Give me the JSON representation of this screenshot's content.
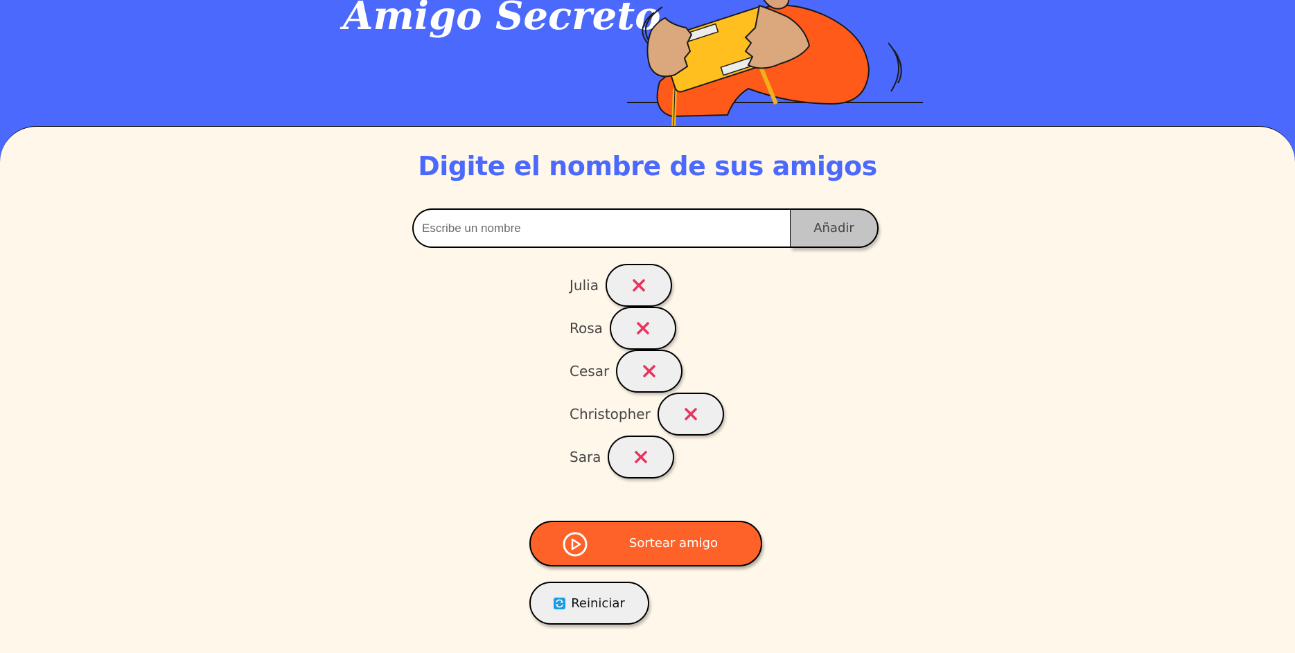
{
  "header": {
    "title": "Amigo Secreto",
    "illustration": "person-holding-gift-illustration"
  },
  "main": {
    "heading": "Digite el nombre de sus amigos",
    "input_placeholder": "Escribe un nombre",
    "input_value": "",
    "add_label": "Añadir",
    "friends": [
      "Julia",
      "Rosa",
      "Cesar",
      "Christopher",
      "Sara"
    ],
    "remove_icon": "close-icon",
    "draw_label": "Sortear amigo",
    "draw_icon": "play-circle-icon",
    "reset_label": "Reiniciar",
    "reset_icon": "refresh-icon"
  },
  "colors": {
    "header_bg": "#4b69fd",
    "panel_bg": "#fff8ea",
    "heading": "#4b69fd",
    "draw_button": "#ff6228",
    "remove_x": "#e8335c",
    "reset_icon": "#1a9be6"
  }
}
